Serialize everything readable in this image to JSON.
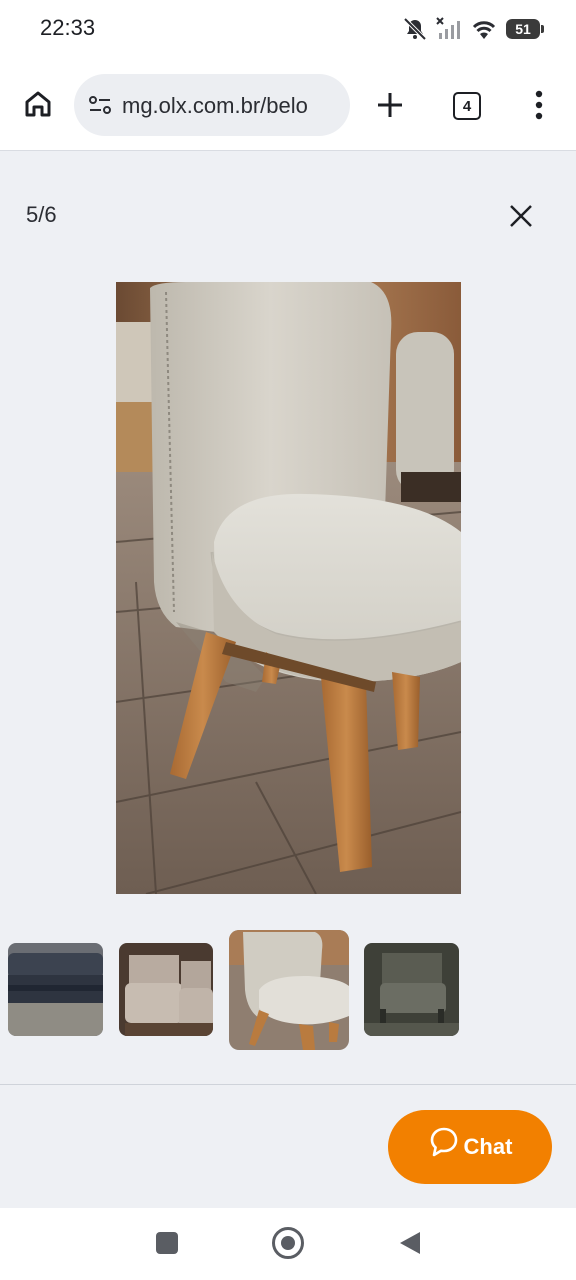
{
  "status_bar": {
    "time": "22:33",
    "battery_level": "51",
    "icons": [
      "mute-icon",
      "signal-icon",
      "wifi-icon",
      "battery-icon"
    ]
  },
  "browser": {
    "url": "mg.olx.com.br/belo",
    "tab_count": "4",
    "icons": [
      "home-icon",
      "site-settings-icon",
      "new-tab-icon",
      "tabs-icon",
      "more-menu-icon"
    ]
  },
  "gallery": {
    "counter": "5/6",
    "current_index": 5,
    "total": 6,
    "thumbnails": [
      {
        "subject": "dark sofa"
      },
      {
        "subject": "two chairs with wooden frames"
      },
      {
        "subject": "beige chair",
        "selected": true
      },
      {
        "subject": "dark chair"
      }
    ]
  },
  "chat_button": {
    "label": "Chat",
    "color": "#f28000"
  },
  "navigation": {
    "icons": [
      "recents-icon",
      "home-icon",
      "back-icon"
    ]
  },
  "colors": {
    "background": "#eef0f4",
    "accent": "#f28000"
  }
}
